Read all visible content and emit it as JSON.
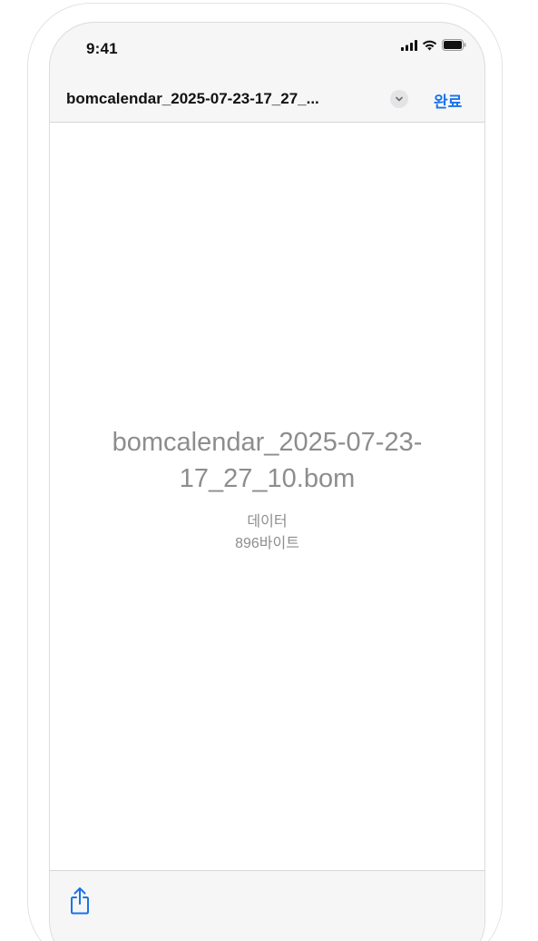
{
  "status_bar": {
    "time": "9:41"
  },
  "nav": {
    "title": "bomcalendar_2025-07-23-17_27_...",
    "done_label": "완료"
  },
  "file": {
    "name": "bomcalendar_2025-07-23-17_27_10.bom",
    "kind": "데이터",
    "size": "896바이트"
  },
  "toolbar": {
    "share_icon": "share-icon"
  },
  "colors": {
    "accent": "#1a73e8",
    "muted_text": "#8d8d8d",
    "chrome_bg": "#f6f6f6"
  }
}
